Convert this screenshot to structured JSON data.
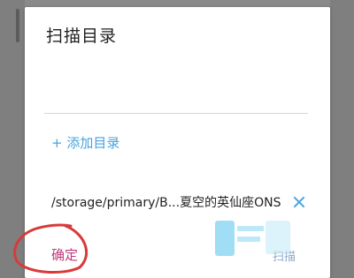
{
  "dialog": {
    "title": "扫描目录",
    "add_directory_label": "+ 添加目录",
    "directories": [
      {
        "path": "/storage/primary/B...夏空的英仙座ONS"
      }
    ],
    "confirm_label": "确定",
    "right_button_label": "扫描"
  },
  "colors": {
    "accent": "#4aa3df",
    "confirm": "#c0387a",
    "annotation": "#d83a3a"
  },
  "icons": {
    "remove": "close-icon"
  }
}
